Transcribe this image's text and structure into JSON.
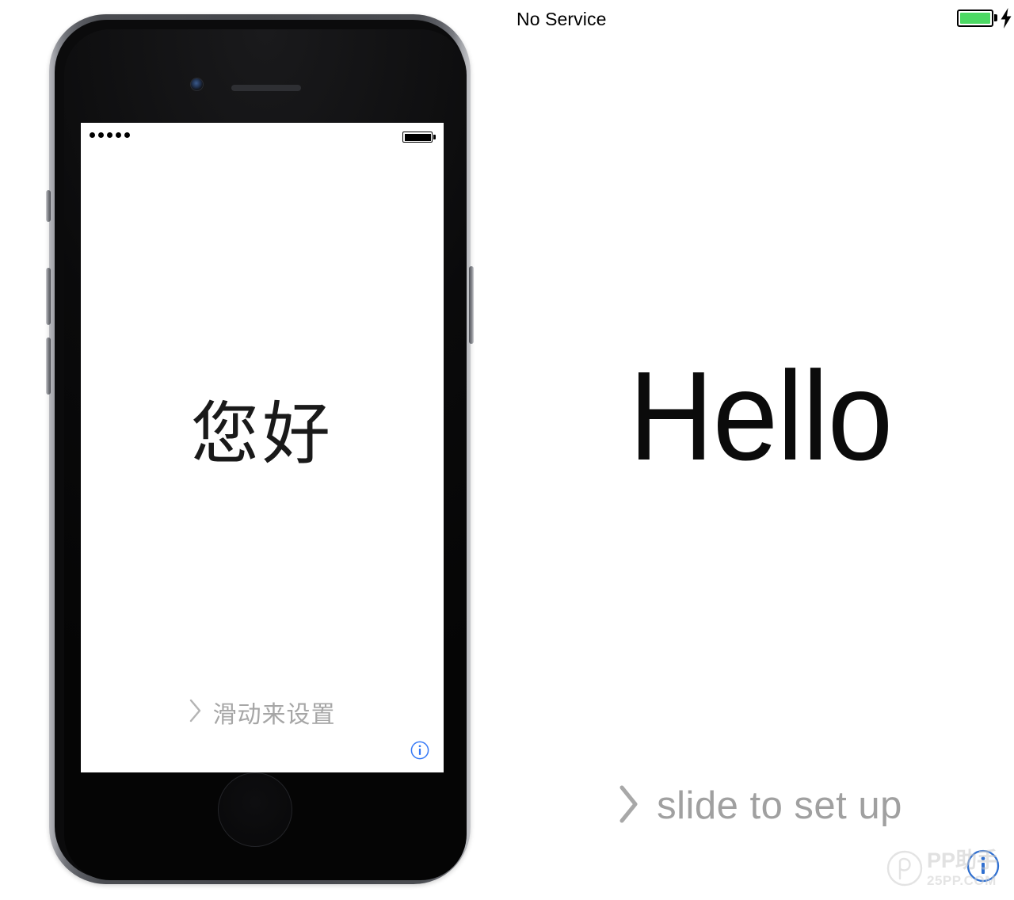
{
  "host_status_bar": {
    "carrier": "No Service",
    "battery_icon": "battery-full-icon",
    "battery_level_percent": 100,
    "battery_color": "#4cd964",
    "charging_icon": "lightning-bolt-icon",
    "charging": true
  },
  "device": {
    "name": "iphone-device",
    "color": "space-gray",
    "hardware": {
      "front_camera": "front-camera-icon",
      "earpiece": "earpiece-speaker-icon",
      "home_button": "home-button",
      "mute_switch": "mute-switch-button",
      "volume_up": "volume-up-button",
      "volume_down": "volume-down-button",
      "power": "power-button"
    },
    "screen": {
      "status_bar": {
        "signal_dots": 5,
        "signal_icon": "signal-dots-icon",
        "battery_icon": "battery-full-icon"
      },
      "greeting": "您好",
      "slide_label": "滑动来设置",
      "slide_chevron_icon": "chevron-right-icon",
      "info_icon": "info-circle-icon",
      "info_color": "#3478f6"
    }
  },
  "host_panel": {
    "greeting": "Hello",
    "slide_label": "slide to set up",
    "slide_chevron_icon": "chevron-right-icon",
    "slide_color": "#a0a0a0",
    "info_icon": "info-circle-icon",
    "info_color": "#2f6fd0"
  },
  "watermark": {
    "logo_icon": "pp-logo-icon",
    "title": "PP助手",
    "subtitle": "25PP.COM",
    "color": "#c9c9c9"
  }
}
